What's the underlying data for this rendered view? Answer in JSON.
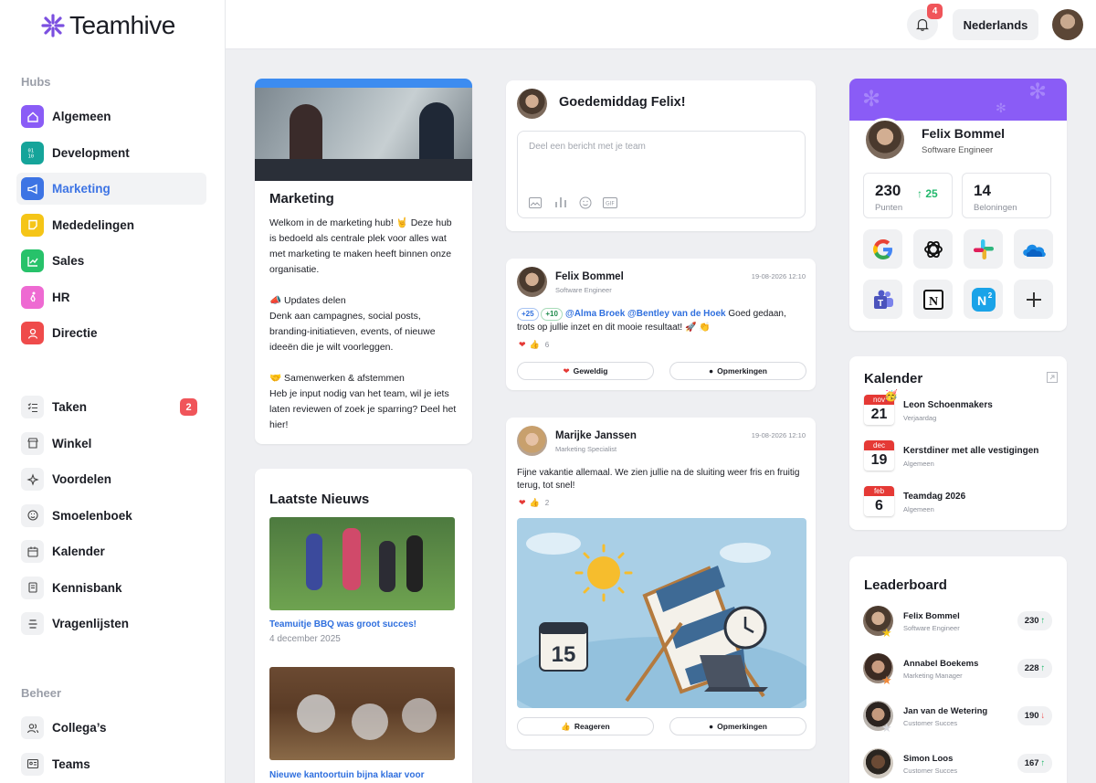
{
  "app": {
    "name": "Teamhive"
  },
  "sidebar": {
    "hubs_label": "Hubs",
    "hubs": [
      {
        "label": "Algemeen",
        "color": "#8a5cf6"
      },
      {
        "label": "Development",
        "color": "#15a49a"
      },
      {
        "label": "Marketing",
        "color": "#3d74e4"
      },
      {
        "label": "Mededelingen",
        "color": "#f5c517"
      },
      {
        "label": "Sales",
        "color": "#27c26a"
      },
      {
        "label": "HR",
        "color": "#ee6ad2"
      },
      {
        "label": "Directie",
        "color": "#ef4b4b"
      }
    ],
    "tools": [
      {
        "label": "Taken",
        "badge": "2"
      },
      {
        "label": "Winkel"
      },
      {
        "label": "Voordelen"
      },
      {
        "label": "Smoelenboek"
      },
      {
        "label": "Kalender"
      },
      {
        "label": "Kennisbank"
      },
      {
        "label": "Vragenlijsten"
      }
    ],
    "beheer_label": "Beheer",
    "beheer": [
      {
        "label": "Collega’s"
      },
      {
        "label": "Teams"
      }
    ]
  },
  "header": {
    "notifications": "4",
    "language": "Nederlands"
  },
  "hub_card": {
    "title": "Marketing",
    "p1": "Welkom in de marketing hub! 🤘 Deze hub is bedoeld als centrale plek voor alles wat met marketing te maken heeft binnen onze organisatie.",
    "p2_title": "📣 Updates delen",
    "p2": "Denk aan campagnes, social posts, branding-initiatieven, events, of nieuwe ideeën die je wilt voorleggen.",
    "p3_title": "🤝 Samenwerken & afstemmen",
    "p3": "Heb je input nodig van het team, wil je iets laten reviewen of zoek je sparring? Deel het hier!"
  },
  "news": {
    "title": "Laatste Nieuws",
    "items": [
      {
        "title": "Teamuitje BBQ was groot succes!",
        "date": "4 december 2025"
      },
      {
        "title": "Nieuwe kantoortuin bijna klaar voor"
      }
    ]
  },
  "composer": {
    "greeting": "Goedemiddag Felix!",
    "placeholder": "Deel een bericht met je team"
  },
  "posts": [
    {
      "author": "Felix Bommel",
      "role": "Software Engineer",
      "time": "19-08-2026 12:10",
      "tag1": "+25",
      "tag2": "+10",
      "mentions": "@Alma Broek @Bentley van de Hoek",
      "text": " Goed gedaan, trots op jullie inzet en dit mooie resultaat! 🚀 👏",
      "reactions": "6",
      "btn1": "Geweldig",
      "btn2": "Opmerkingen"
    },
    {
      "author": "Marijke Janssen",
      "role": "Marketing Specialist",
      "time": "19-08-2026 12:10",
      "text": "Fijne vakantie allemaal. We zien jullie na de sluiting weer fris en fruitig terug, tot snel!",
      "reactions": "2",
      "calendar_number": "15",
      "btn1": "Reageren",
      "btn2": "Opmerkingen"
    }
  ],
  "profile": {
    "name": "Felix Bommel",
    "role": "Software Engineer",
    "points": "230",
    "points_label": "Punten",
    "points_delta": "25",
    "rewards": "14",
    "rewards_label": "Beloningen",
    "apps": [
      "google-icon",
      "openai-icon",
      "slack-icon",
      "onedrive-icon",
      "teams-icon",
      "notion-icon",
      "n2-icon",
      "plus-icon"
    ]
  },
  "calendar": {
    "title": "Kalender",
    "events": [
      {
        "month": "nov",
        "day": "21",
        "title": "Leon Schoenmakers",
        "sub": "Verjaardag"
      },
      {
        "month": "dec",
        "day": "19",
        "title": "Kerstdiner met alle vestigingen",
        "sub": "Algemeen"
      },
      {
        "month": "feb",
        "day": "6",
        "title": "Teamdag 2026",
        "sub": "Algemeen"
      }
    ]
  },
  "leaderboard": {
    "title": "Leaderboard",
    "rows": [
      {
        "name": "Felix Bommel",
        "role": "Software Engineer",
        "score": "230",
        "trend": "↑",
        "trend_color": "#22b86c",
        "medal_color": "#f5c517"
      },
      {
        "name": "Annabel Boekems",
        "role": "Marketing Manager",
        "score": "228",
        "trend": "↑",
        "trend_color": "#22b86c",
        "medal_color": "#f08a3c"
      },
      {
        "name": "Jan van de Wetering",
        "role": "Customer Succes",
        "score": "190",
        "trend": "↓",
        "trend_color": "#ef4b4b",
        "medal_color": "#d7d9de"
      },
      {
        "name": "Simon Loos",
        "role": "Customer Succes",
        "score": "167",
        "trend": "↑",
        "trend_color": "#22b86c"
      }
    ]
  }
}
